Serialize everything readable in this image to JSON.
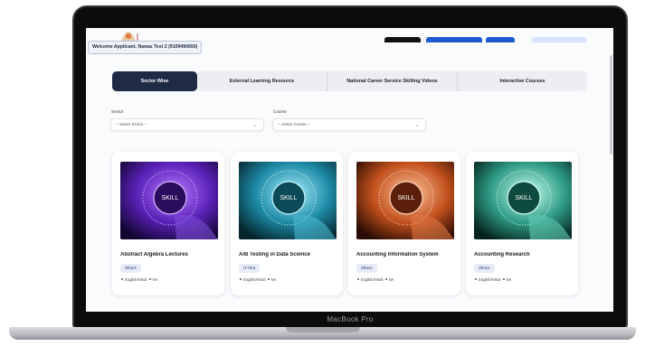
{
  "laptop": {
    "brand": "MacBook Pro"
  },
  "header": {
    "welcome_text": "Welcome Applicant, Nawaz Test 2 (9109490659)",
    "button_colors": [
      "#111111",
      "#1e5bd1",
      "#1e5bd1",
      "#d6e4ff"
    ]
  },
  "tabs": [
    {
      "label": "Sector Wise",
      "active": true
    },
    {
      "label": "External Learning Resource",
      "active": false
    },
    {
      "label": "National Career Service Skilling Videos",
      "active": false
    },
    {
      "label": "Interactive Courses",
      "active": false
    }
  ],
  "filters": {
    "sector": {
      "label": "Sector",
      "value": "-- Select Sector --"
    },
    "course": {
      "label": "Course",
      "value": "-- Select Course --"
    }
  },
  "cards": [
    {
      "title": "Abstract Algebra Lectures",
      "badge": "Others",
      "language": "English/Hindi",
      "duration": "NA",
      "theme": "purple",
      "image_text": "SKILL"
    },
    {
      "title": "A/B Testing in Data Science",
      "badge": "IT-ITeS",
      "language": "English/Hindi",
      "duration": "NA",
      "theme": "cyan",
      "image_text": "SKILL"
    },
    {
      "title": "Accounting Information System",
      "badge": "Others",
      "language": "English/Hindi",
      "duration": "NA",
      "theme": "orange",
      "image_text": "SKILL"
    },
    {
      "title": "Accounting Research",
      "badge": "Others",
      "language": "English/Hindi",
      "duration": "NA",
      "theme": "teal",
      "image_text": "SKILL"
    }
  ],
  "colors": {
    "primary": "#1f2a44",
    "badge_bg": "#e6ebf7"
  }
}
